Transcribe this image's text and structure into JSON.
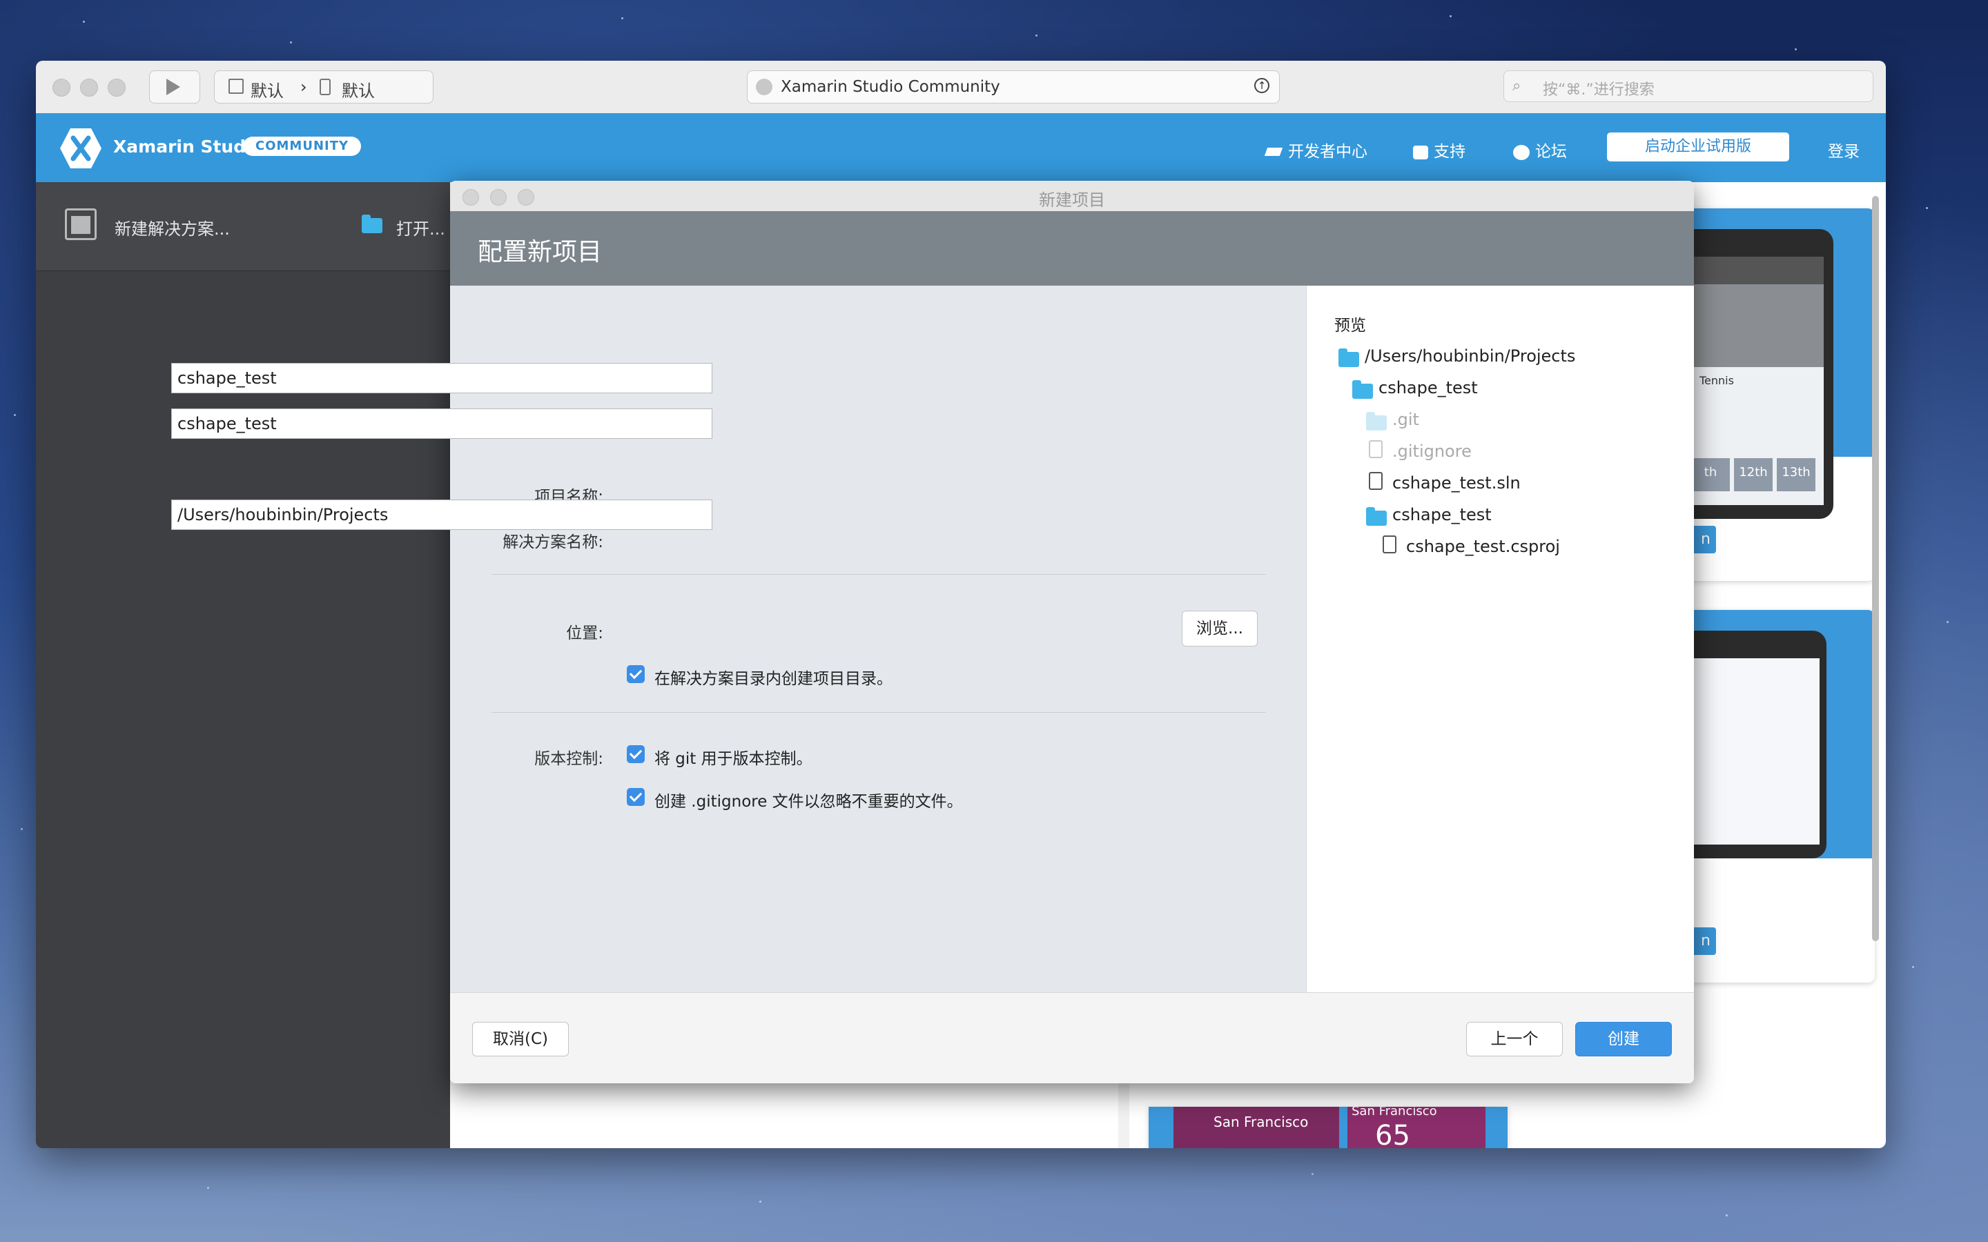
{
  "toolbar": {
    "config_left": "默认",
    "config_right": "默认",
    "window_title": "Xamarin Studio Community",
    "search_placeholder": "按“⌘.”进行搜索"
  },
  "header": {
    "brand": "Xamarin Studio",
    "edition_badge": "COMMUNITY",
    "links": [
      "开发者中心",
      "支持",
      "论坛"
    ],
    "trial_button": "启动企业试用版",
    "login": "登录"
  },
  "sidebar": {
    "new_solution": "新建解决方案...",
    "open": "打开..."
  },
  "dialog": {
    "title": "新建项目",
    "heading": "配置新项目",
    "fields": {
      "project_name_label": "项目名称:",
      "project_name_value": "cshape_test",
      "solution_name_label": "解决方案名称:",
      "solution_name_value": "cshape_test",
      "location_label": "位置:",
      "location_value": "/Users/houbinbin/Projects",
      "browse_button": "浏览...",
      "create_dir_label": "在解决方案目录内创建项目目录。",
      "vcs_label": "版本控制:",
      "use_git_label": "将 git 用于版本控制。",
      "gitignore_label": "创建 .gitignore 文件以忽略不重要的文件。"
    },
    "preview": {
      "title": "预览",
      "tree": [
        "/Users/houbinbin/Projects",
        "cshape_test",
        ".git",
        ".gitignore",
        "cshape_test.sln",
        "cshape_test",
        "cshape_test.csproj"
      ]
    },
    "buttons": {
      "cancel": "取消(C)",
      "previous": "上一个",
      "create": "创建"
    }
  },
  "background_cards": {
    "card1_tabs": [
      "th",
      "12th",
      "13th"
    ],
    "card1_title": "Tennis",
    "card_button_fragment": "n",
    "weather_city": "San Francisco",
    "weather_city_2": "San Francisco",
    "weather_temp": "65"
  },
  "colors": {
    "accent": "#3498db",
    "checkbox": "#3a8ee6",
    "folder": "#3fb4e8"
  }
}
